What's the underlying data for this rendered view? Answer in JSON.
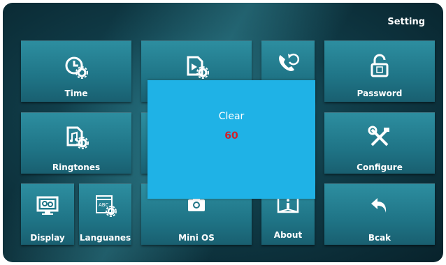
{
  "header": {
    "title": "Setting"
  },
  "tiles": {
    "time": {
      "label": "Time",
      "icon": "clock-gear-icon"
    },
    "video": {
      "label": "",
      "icon": "video-gear-icon"
    },
    "phone": {
      "label": "",
      "icon": "phone-refresh-icon"
    },
    "password": {
      "label": "Password",
      "icon": "lock-icon"
    },
    "ringtones": {
      "label": "Ringtones",
      "icon": "music-file-gear-icon"
    },
    "configure": {
      "label": "Configure",
      "icon": "tools-icon"
    },
    "display": {
      "label": "Display",
      "icon": "monitor-gear-icon"
    },
    "languages": {
      "label": "Languanes",
      "icon": "abc-window-gear-icon"
    },
    "minios": {
      "label": "Mini OS",
      "icon": "camera-icon"
    },
    "about": {
      "label": "About",
      "icon": "info-book-icon"
    },
    "back": {
      "label": "Bcak",
      "icon": "back-arrow-icon"
    }
  },
  "dialog": {
    "title": "Clear",
    "countdown": "60"
  },
  "colors": {
    "tile": "#2d8ea0",
    "dialog": "#1fb2e6",
    "countdown": "#d0202a",
    "background": "#103c48"
  }
}
